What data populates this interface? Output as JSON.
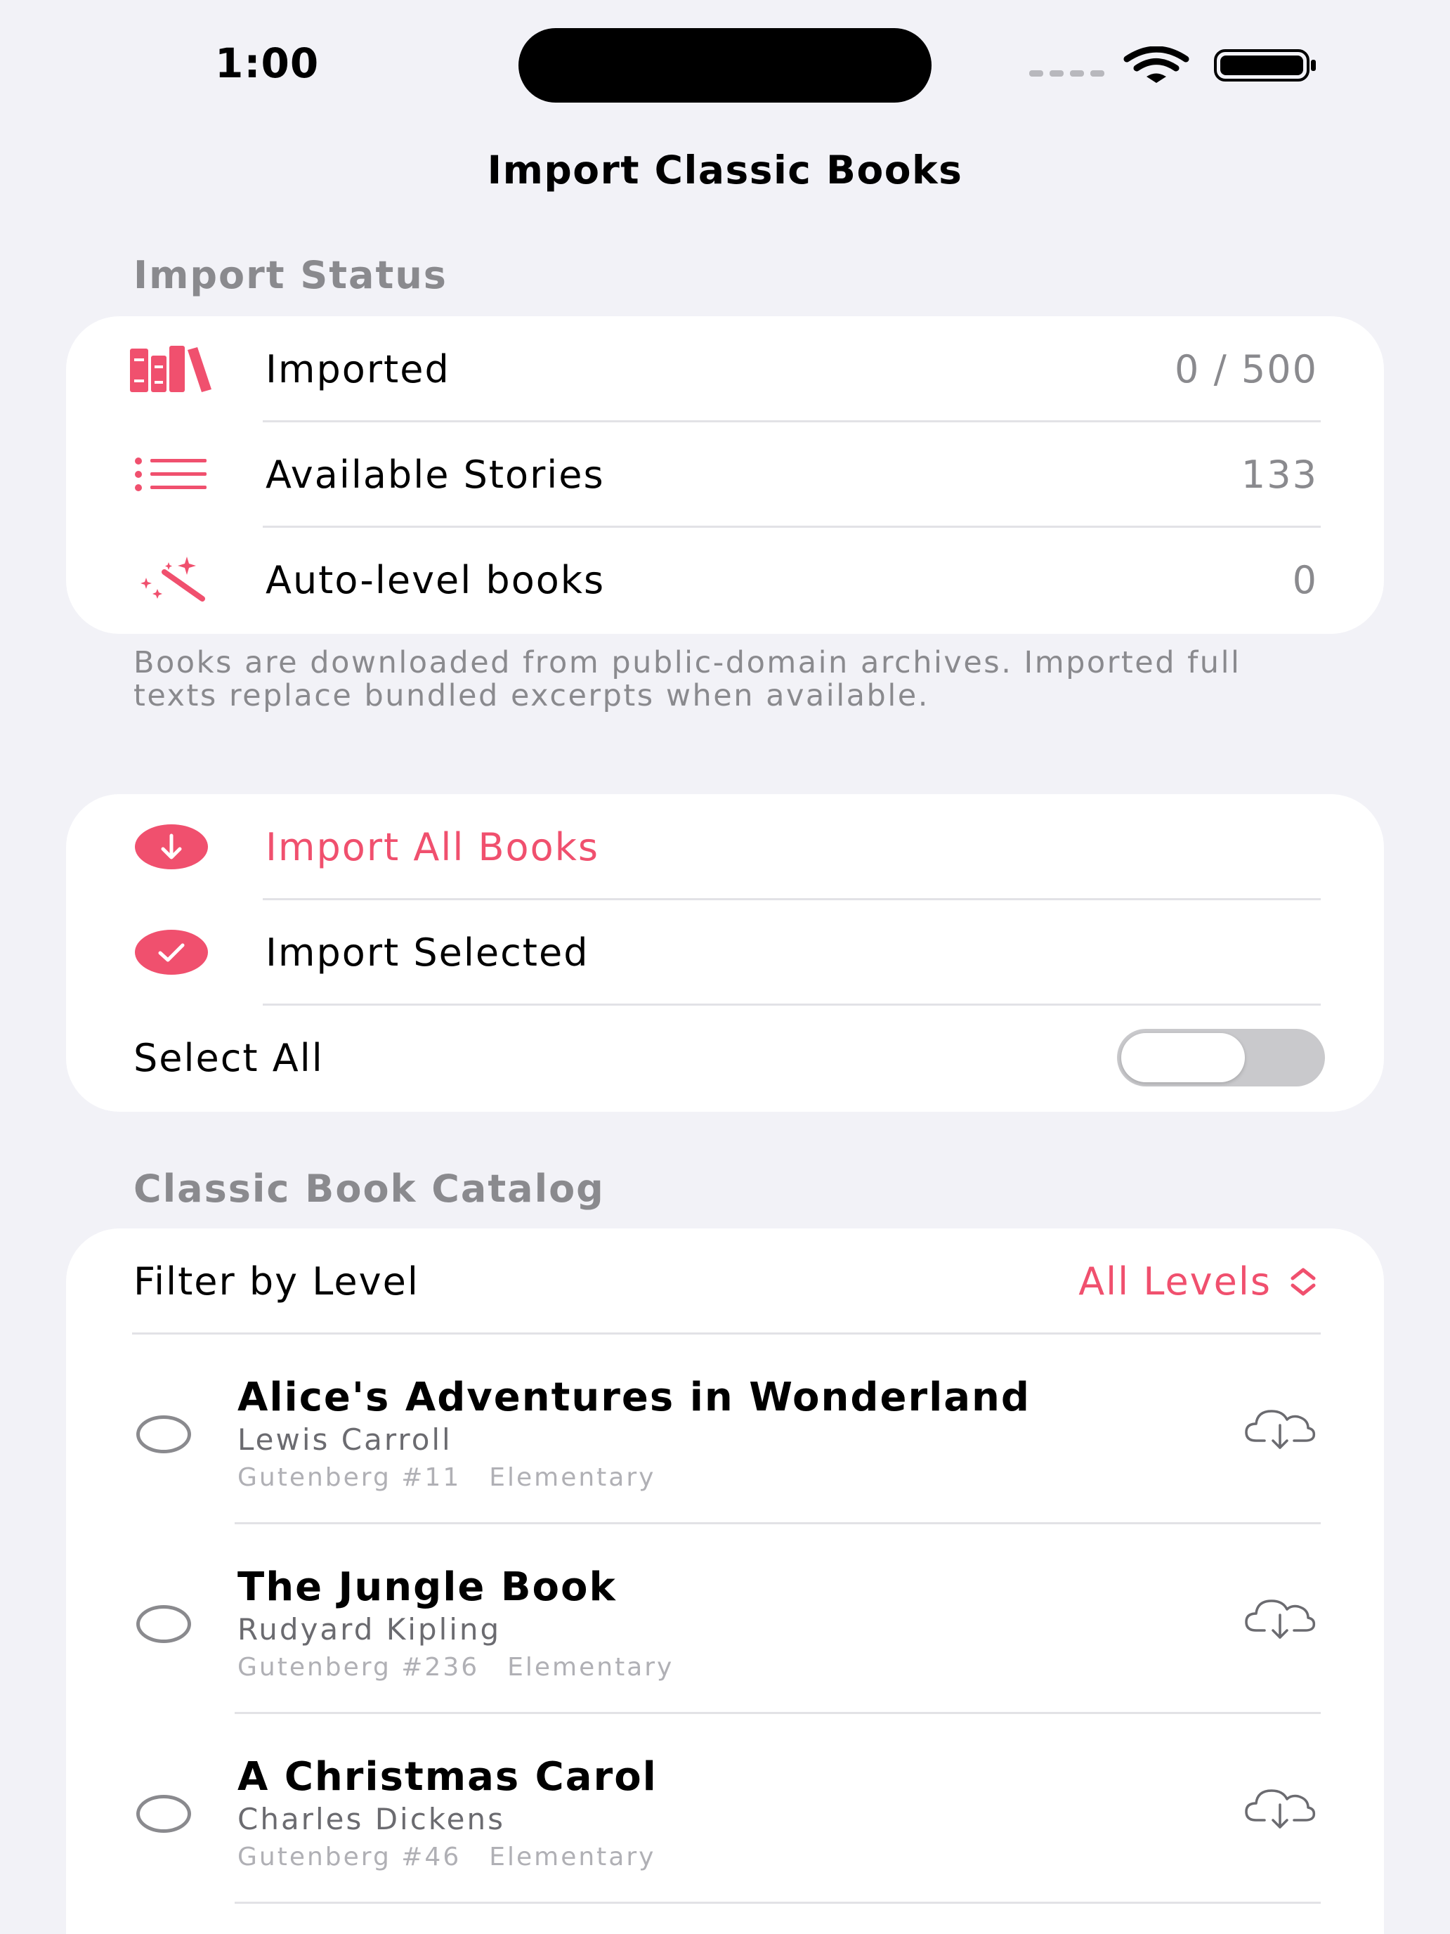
{
  "status_bar": {
    "time": "1:00"
  },
  "nav": {
    "title": "Import Classic Books"
  },
  "import_status": {
    "header": "Import Status",
    "rows": [
      {
        "icon": "books-icon",
        "label": "Imported",
        "value": "0 / 500"
      },
      {
        "icon": "list-icon",
        "label": "Available Stories",
        "value": "133"
      },
      {
        "icon": "magic-wand-icon",
        "label": "Auto-level books",
        "value": "0"
      }
    ],
    "footer": "Books are downloaded from public-domain archives. Imported full texts replace bundled excerpts when available."
  },
  "actions": {
    "import_all": "Import All Books",
    "import_selected": "Import Selected",
    "select_all": "Select All",
    "select_all_on": false
  },
  "catalog": {
    "header": "Classic Book Catalog",
    "filter_label": "Filter by Level",
    "filter_value": "All Levels",
    "books": [
      {
        "title": "Alice's Adventures in Wonderland",
        "author": "Lewis Carroll",
        "source": "Gutenberg #11",
        "level": "Elementary"
      },
      {
        "title": "The Jungle Book",
        "author": "Rudyard Kipling",
        "source": "Gutenberg #236",
        "level": "Elementary"
      },
      {
        "title": "A Christmas Carol",
        "author": "Charles Dickens",
        "source": "Gutenberg #46",
        "level": "Elementary"
      }
    ]
  },
  "colors": {
    "accent": "#f0506e",
    "background": "#f2f2f7",
    "secondary_text": "#8a8a8e"
  }
}
